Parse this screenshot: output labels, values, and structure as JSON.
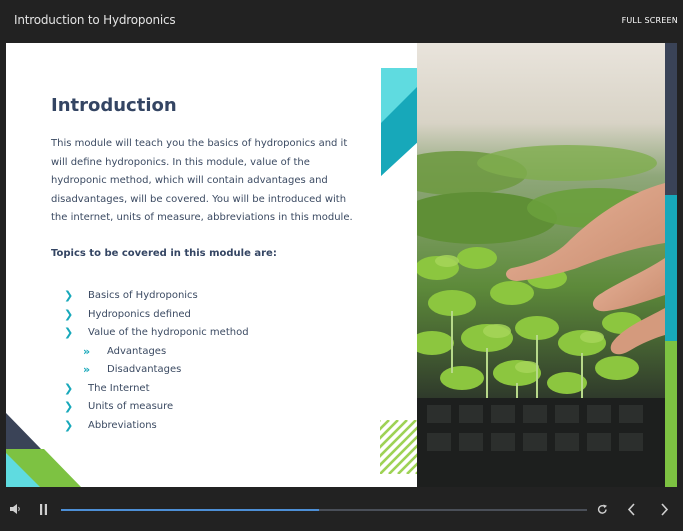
{
  "window": {
    "course_title": "Introduction to Hydroponics",
    "fullscreen_label": "FULL SCREEN"
  },
  "slide": {
    "heading": "Introduction",
    "intro_text": "This module will teach you the basics of hydroponics and it will define hydroponics. In this module, value of the hydroponic method, which will contain advantages and disadvantages, will be covered. You will be introduced with the internet, units of measure, abbreviations in this module.",
    "topics_heading": "Topics to be covered in this module are:",
    "topics": [
      {
        "label": "Basics of Hydroponics",
        "level": 1
      },
      {
        "label": "Hydroponics defined",
        "level": 1
      },
      {
        "label": "Value of the hydroponic method",
        "level": 1
      },
      {
        "label": "Advantages",
        "level": 2
      },
      {
        "label": "Disadvantages",
        "level": 2
      },
      {
        "label": "The Internet",
        "level": 1
      },
      {
        "label": "Units of measure",
        "level": 1
      },
      {
        "label": "Abbreviations",
        "level": 1
      }
    ],
    "bullet_icons": {
      "level1": "chevron-right-icon",
      "level2": "double-chevron-right-icon"
    },
    "colors": {
      "heading": "#344563",
      "body_text": "#3b4a62",
      "accent_teal": "#17a8ba",
      "accent_light_teal": "#5fdbe0",
      "accent_green": "#7dc242",
      "accent_navy": "#3a4357"
    }
  },
  "player": {
    "progress_fraction": 0.49,
    "icons": {
      "volume": "speaker-icon",
      "pause": "pause-icon",
      "replay": "replay-icon",
      "prev": "chevron-left-icon",
      "next": "chevron-right-icon"
    },
    "progress_color": "#4d8fd6"
  }
}
